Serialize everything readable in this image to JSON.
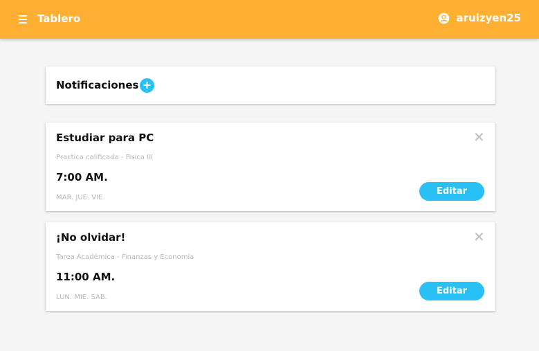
{
  "header": {
    "title": "Tablero",
    "username": "aruizyen25",
    "menu_icon": "hamburger-icon",
    "user_icon": "user-circle-icon"
  },
  "notifications": {
    "title": "Notificaciones",
    "add_symbol": "+"
  },
  "tasks": [
    {
      "title": "Estudiar para PC",
      "subtitle": "Practica calificada - Fisica III",
      "time": "7:00 AM.",
      "days": "MAR. JUE. VIE.",
      "edit_label": "Editar",
      "close_symbol": "✕"
    },
    {
      "title": "¡No olvidar!",
      "subtitle": "Tarea Académica - Finanzas y Economía",
      "time": "11:00 AM.",
      "days": "LUN. MIE. SAB.",
      "edit_label": "Editar",
      "close_symbol": "✕"
    }
  ],
  "colors": {
    "header_bg": "#ffb033",
    "accent": "#29c0f5",
    "page_bg": "#f5f5f5",
    "muted_text": "#b8b8b8"
  }
}
